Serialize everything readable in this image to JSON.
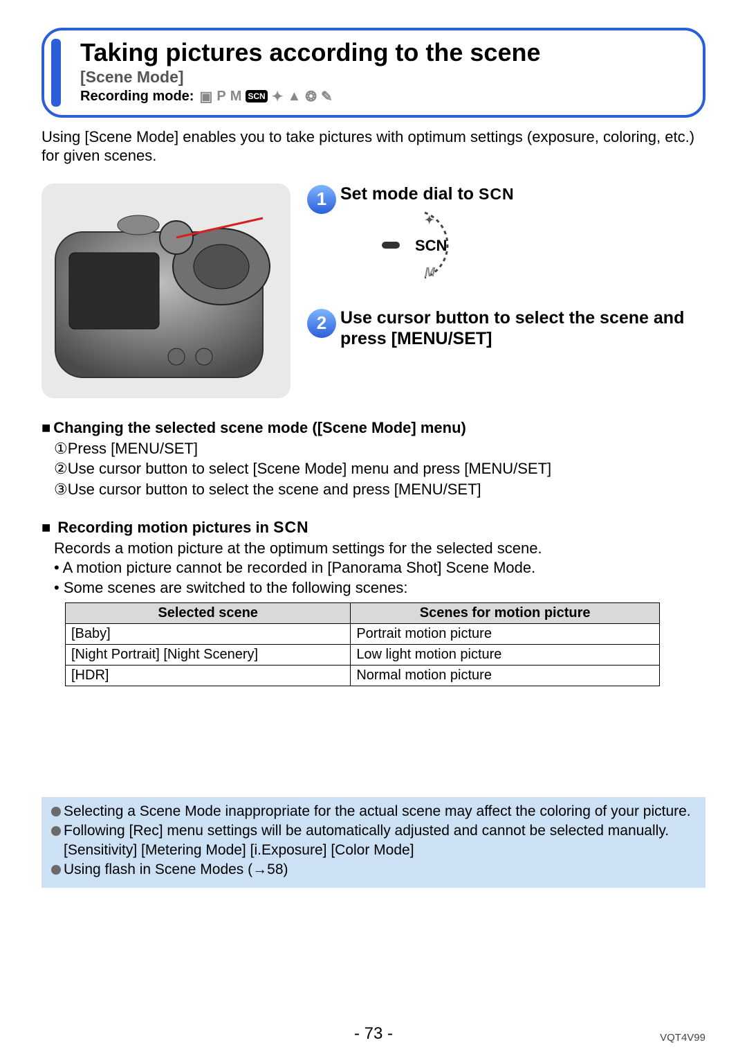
{
  "header": {
    "title": "Taking pictures according to the scene",
    "subtitle": "[Scene Mode]",
    "recording_mode_label": "Recording mode:"
  },
  "intro": "Using [Scene Mode] enables you to take pictures with optimum settings (exposure, coloring, etc.) for given scenes.",
  "steps": {
    "s1": {
      "num": "1",
      "text_a": "Set mode dial to ",
      "scn": "SCN"
    },
    "s2": {
      "num": "2",
      "text": "Use cursor button to select the scene and press [MENU/SET]"
    }
  },
  "section_change": {
    "heading": "Changing the selected scene mode ([Scene Mode] menu)",
    "items": {
      "i1": "①Press [MENU/SET]",
      "i2": "②Use cursor button to select [Scene Mode] menu and press [MENU/SET]",
      "i3": "③Use cursor button to select the scene and press [MENU/SET]"
    }
  },
  "section_motion": {
    "heading_a": "Recording motion pictures in ",
    "heading_scn": "SCN",
    "line1": "Records a motion picture at the optimum settings for the selected scene.",
    "bullets": {
      "b1": "A motion picture cannot be recorded in [Panorama Shot] Scene Mode.",
      "b2": "Some scenes are switched to the following scenes:"
    }
  },
  "table": {
    "h1": "Selected scene",
    "h2": "Scenes for motion picture",
    "rows": [
      {
        "c1": "[Baby]",
        "c2": "Portrait motion picture"
      },
      {
        "c1": "[Night Portrait] [Night Scenery]",
        "c2": "Low light motion picture"
      },
      {
        "c1": "[HDR]",
        "c2": "Normal motion picture"
      }
    ]
  },
  "notes": {
    "n1": "Selecting a Scene Mode inappropriate for the actual scene may affect the coloring of your picture.",
    "n2": "Following [Rec] menu settings will be automatically adjusted and cannot be selected manually.",
    "n2b": "[Sensitivity] [Metering Mode] [i.Exposure] [Color Mode]",
    "n3": "Using flash in Scene Modes (→58)"
  },
  "footer": {
    "page": "- 73 -",
    "doc": "VQT4V99"
  }
}
